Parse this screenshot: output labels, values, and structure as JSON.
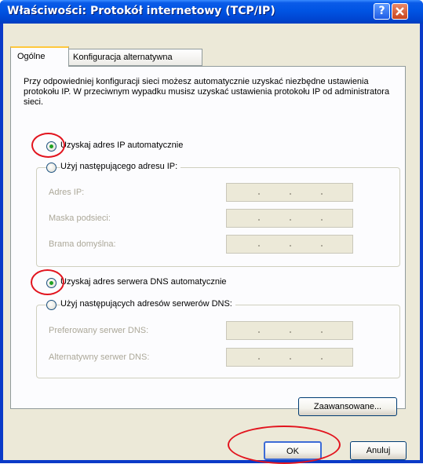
{
  "window": {
    "title": "Właściwości: Protokół internetowy (TCP/IP)",
    "help_label": "?",
    "close_label": "✕"
  },
  "tabs": [
    {
      "label": "Ogólne",
      "active": true
    },
    {
      "label": "Konfiguracja alternatywna",
      "active": false
    }
  ],
  "description": "Przy odpowiedniej konfiguracji sieci możesz automatycznie uzyskać niezbędne ustawienia protokołu IP. W przeciwnym wypadku musisz uzyskać ustawienia protokołu IP od administratora sieci.",
  "ip": {
    "auto_label": "Uzyskaj adres IP automatycznie",
    "auto_selected": true,
    "manual_label": "Użyj następującego adresu IP:",
    "fields": [
      {
        "label": "Adres IP:",
        "value": ""
      },
      {
        "label": "Maska podsieci:",
        "value": ""
      },
      {
        "label": "Brama domyślna:",
        "value": ""
      }
    ]
  },
  "dns": {
    "auto_label": "Uzyskaj adres serwera DNS automatycznie",
    "auto_selected": true,
    "manual_label": "Użyj następujących adresów serwerów DNS:",
    "fields": [
      {
        "label": "Preferowany serwer DNS:",
        "value": ""
      },
      {
        "label": "Alternatywny serwer DNS:",
        "value": ""
      }
    ]
  },
  "buttons": {
    "advanced": "Zaawansowane...",
    "ok": "OK",
    "cancel": "Anuluj"
  },
  "colors": {
    "titlebar": "#0054E3",
    "dialog_bg": "#ECE9D8",
    "annotation": "#E2141E"
  }
}
